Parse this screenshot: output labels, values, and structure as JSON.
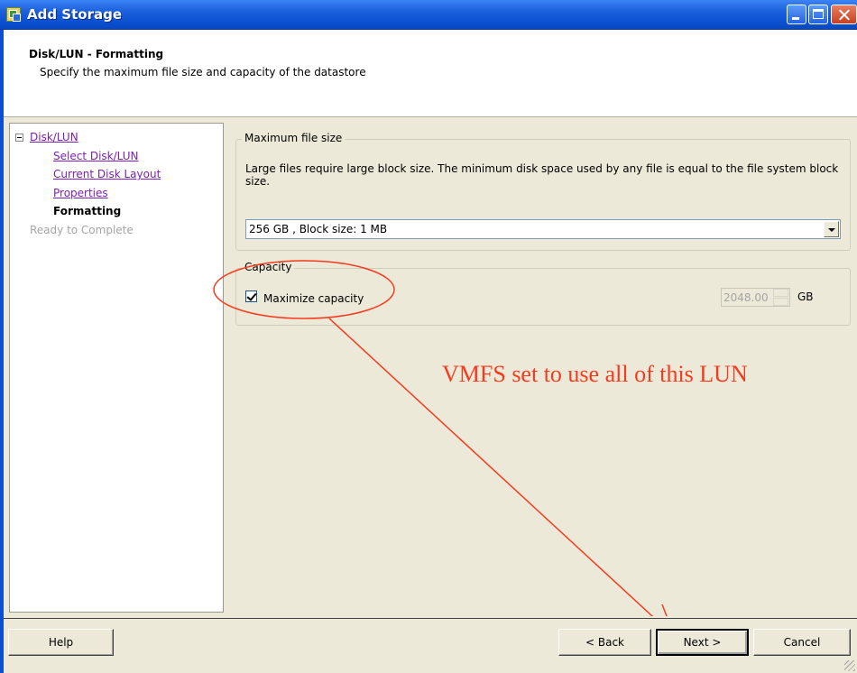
{
  "window": {
    "title": "Add Storage"
  },
  "header": {
    "title": "Disk/LUN - Formatting",
    "subtitle": "Specify the maximum file size and capacity of the datastore"
  },
  "nav": {
    "root": "Disk/LUN",
    "items": [
      {
        "label": "Select Disk/LUN",
        "state": "link"
      },
      {
        "label": "Current Disk Layout",
        "state": "link"
      },
      {
        "label": "Properties",
        "state": "link"
      },
      {
        "label": "Formatting",
        "state": "current"
      }
    ],
    "after": "Ready to Complete"
  },
  "max_file_size": {
    "group_label": "Maximum file size",
    "description": "Large files require large block size.  The minimum disk space used by any file is equal to the file system block size.",
    "selected": "256 GB  ,  Block size: 1 MB"
  },
  "capacity": {
    "group_label": "Capacity",
    "checkbox_label": "Maximize capacity",
    "checked": true,
    "value": "2048.00",
    "unit": "GB"
  },
  "annotation": {
    "text": "VMFS set to use all of this LUN",
    "color": "#f53a1e"
  },
  "footer": {
    "help": "Help",
    "back": "< Back",
    "next": "Next >",
    "cancel": "Cancel"
  }
}
